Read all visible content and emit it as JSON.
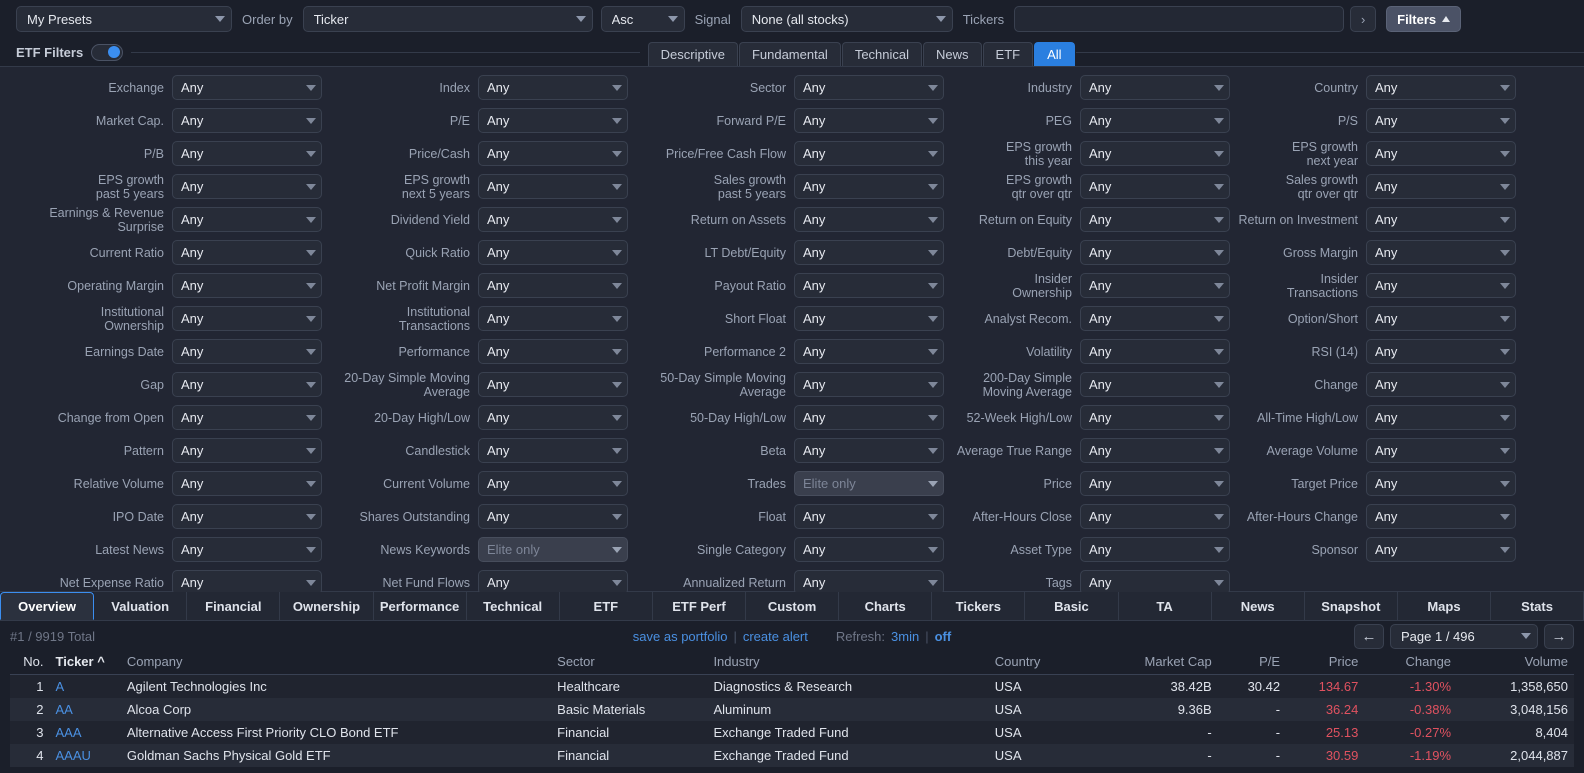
{
  "topbar": {
    "presets_value": "My Presets",
    "orderby_label": "Order by",
    "orderby_value": "Ticker",
    "direction_value": "Asc",
    "signal_label": "Signal",
    "signal_value": "None (all stocks)",
    "tickers_label": "Tickers",
    "tickers_value": "",
    "tickers_placeholder": "",
    "expand_icon": "chevron-right-icon",
    "filters_label": "Filters"
  },
  "secondbar": {
    "etf_filters_label": "ETF Filters",
    "etf_filters_on": true,
    "category_tabs": [
      {
        "label": "Descriptive",
        "active": false
      },
      {
        "label": "Fundamental",
        "active": false
      },
      {
        "label": "Technical",
        "active": false
      },
      {
        "label": "News",
        "active": false
      },
      {
        "label": "ETF",
        "active": false
      },
      {
        "label": "All",
        "active": true
      }
    ]
  },
  "filters": [
    [
      {
        "label": "Exchange",
        "value": "Any",
        "elite": false
      },
      {
        "label": "Index",
        "value": "Any",
        "elite": false
      },
      {
        "label": "Sector",
        "value": "Any",
        "elite": false
      },
      {
        "label": "Industry",
        "value": "Any",
        "elite": false
      },
      {
        "label": "Country",
        "value": "Any",
        "elite": false
      }
    ],
    [
      {
        "label": "Market Cap.",
        "value": "Any",
        "elite": false
      },
      {
        "label": "P/E",
        "value": "Any",
        "elite": false
      },
      {
        "label": "Forward P/E",
        "value": "Any",
        "elite": false
      },
      {
        "label": "PEG",
        "value": "Any",
        "elite": false
      },
      {
        "label": "P/S",
        "value": "Any",
        "elite": false
      }
    ],
    [
      {
        "label": "P/B",
        "value": "Any",
        "elite": false
      },
      {
        "label": "Price/Cash",
        "value": "Any",
        "elite": false
      },
      {
        "label": "Price/Free Cash Flow",
        "value": "Any",
        "elite": false
      },
      {
        "label": "EPS growth\nthis year",
        "value": "Any",
        "elite": false
      },
      {
        "label": "EPS growth\nnext year",
        "value": "Any",
        "elite": false
      }
    ],
    [
      {
        "label": "EPS growth\npast 5 years",
        "value": "Any",
        "elite": false
      },
      {
        "label": "EPS growth\nnext 5 years",
        "value": "Any",
        "elite": false
      },
      {
        "label": "Sales growth\npast 5 years",
        "value": "Any",
        "elite": false
      },
      {
        "label": "EPS growth\nqtr over qtr",
        "value": "Any",
        "elite": false
      },
      {
        "label": "Sales growth\nqtr over qtr",
        "value": "Any",
        "elite": false
      }
    ],
    [
      {
        "label": "Earnings & Revenue\nSurprise",
        "value": "Any",
        "elite": false
      },
      {
        "label": "Dividend Yield",
        "value": "Any",
        "elite": false
      },
      {
        "label": "Return on Assets",
        "value": "Any",
        "elite": false
      },
      {
        "label": "Return on Equity",
        "value": "Any",
        "elite": false
      },
      {
        "label": "Return on Investment",
        "value": "Any",
        "elite": false
      }
    ],
    [
      {
        "label": "Current Ratio",
        "value": "Any",
        "elite": false
      },
      {
        "label": "Quick Ratio",
        "value": "Any",
        "elite": false
      },
      {
        "label": "LT Debt/Equity",
        "value": "Any",
        "elite": false
      },
      {
        "label": "Debt/Equity",
        "value": "Any",
        "elite": false
      },
      {
        "label": "Gross Margin",
        "value": "Any",
        "elite": false
      }
    ],
    [
      {
        "label": "Operating Margin",
        "value": "Any",
        "elite": false
      },
      {
        "label": "Net Profit Margin",
        "value": "Any",
        "elite": false
      },
      {
        "label": "Payout Ratio",
        "value": "Any",
        "elite": false
      },
      {
        "label": "Insider\nOwnership",
        "value": "Any",
        "elite": false
      },
      {
        "label": "Insider\nTransactions",
        "value": "Any",
        "elite": false
      }
    ],
    [
      {
        "label": "Institutional\nOwnership",
        "value": "Any",
        "elite": false
      },
      {
        "label": "Institutional\nTransactions",
        "value": "Any",
        "elite": false
      },
      {
        "label": "Short Float",
        "value": "Any",
        "elite": false
      },
      {
        "label": "Analyst Recom.",
        "value": "Any",
        "elite": false
      },
      {
        "label": "Option/Short",
        "value": "Any",
        "elite": false
      }
    ],
    [
      {
        "label": "Earnings Date",
        "value": "Any",
        "elite": false
      },
      {
        "label": "Performance",
        "value": "Any",
        "elite": false
      },
      {
        "label": "Performance 2",
        "value": "Any",
        "elite": false
      },
      {
        "label": "Volatility",
        "value": "Any",
        "elite": false
      },
      {
        "label": "RSI (14)",
        "value": "Any",
        "elite": false
      }
    ],
    [
      {
        "label": "Gap",
        "value": "Any",
        "elite": false
      },
      {
        "label": "20-Day Simple Moving\nAverage",
        "value": "Any",
        "elite": false
      },
      {
        "label": "50-Day Simple Moving\nAverage",
        "value": "Any",
        "elite": false
      },
      {
        "label": "200-Day Simple\nMoving Average",
        "value": "Any",
        "elite": false
      },
      {
        "label": "Change",
        "value": "Any",
        "elite": false
      }
    ],
    [
      {
        "label": "Change from Open",
        "value": "Any",
        "elite": false
      },
      {
        "label": "20-Day High/Low",
        "value": "Any",
        "elite": false
      },
      {
        "label": "50-Day High/Low",
        "value": "Any",
        "elite": false
      },
      {
        "label": "52-Week High/Low",
        "value": "Any",
        "elite": false
      },
      {
        "label": "All-Time High/Low",
        "value": "Any",
        "elite": false
      }
    ],
    [
      {
        "label": "Pattern",
        "value": "Any",
        "elite": false
      },
      {
        "label": "Candlestick",
        "value": "Any",
        "elite": false
      },
      {
        "label": "Beta",
        "value": "Any",
        "elite": false
      },
      {
        "label": "Average True Range",
        "value": "Any",
        "elite": false
      },
      {
        "label": "Average Volume",
        "value": "Any",
        "elite": false
      }
    ],
    [
      {
        "label": "Relative Volume",
        "value": "Any",
        "elite": false
      },
      {
        "label": "Current Volume",
        "value": "Any",
        "elite": false
      },
      {
        "label": "Trades",
        "value": "Elite only",
        "elite": true
      },
      {
        "label": "Price",
        "value": "Any",
        "elite": false
      },
      {
        "label": "Target Price",
        "value": "Any",
        "elite": false
      }
    ],
    [
      {
        "label": "IPO Date",
        "value": "Any",
        "elite": false
      },
      {
        "label": "Shares Outstanding",
        "value": "Any",
        "elite": false
      },
      {
        "label": "Float",
        "value": "Any",
        "elite": false
      },
      {
        "label": "After-Hours Close",
        "value": "Any",
        "elite": false
      },
      {
        "label": "After-Hours Change",
        "value": "Any",
        "elite": false
      }
    ],
    [
      {
        "label": "Latest News",
        "value": "Any",
        "elite": false
      },
      {
        "label": "News Keywords",
        "value": "Elite only",
        "elite": true
      },
      {
        "label": "Single Category",
        "value": "Any",
        "elite": false
      },
      {
        "label": "Asset Type",
        "value": "Any",
        "elite": false
      },
      {
        "label": "Sponsor",
        "value": "Any",
        "elite": false
      }
    ],
    [
      {
        "label": "Net Expense Ratio",
        "value": "Any",
        "elite": false
      },
      {
        "label": "Net Fund Flows",
        "value": "Any",
        "elite": false
      },
      {
        "label": "Annualized Return",
        "value": "Any",
        "elite": false
      },
      {
        "label": "Tags",
        "value": "Any",
        "elite": false
      },
      {
        "label": "",
        "value": "",
        "elite": false
      }
    ]
  ],
  "view_tabs": [
    {
      "label": "Overview",
      "active": true
    },
    {
      "label": "Valuation",
      "active": false
    },
    {
      "label": "Financial",
      "active": false
    },
    {
      "label": "Ownership",
      "active": false
    },
    {
      "label": "Performance",
      "active": false
    },
    {
      "label": "Technical",
      "active": false
    },
    {
      "label": "ETF",
      "active": false
    },
    {
      "label": "ETF Perf",
      "active": false
    },
    {
      "label": "Custom",
      "active": false
    },
    {
      "label": "Charts",
      "active": false
    },
    {
      "label": "Tickers",
      "active": false
    },
    {
      "label": "Basic",
      "active": false
    },
    {
      "label": "TA",
      "active": false
    },
    {
      "label": "News",
      "active": false
    },
    {
      "label": "Snapshot",
      "active": false
    },
    {
      "label": "Maps",
      "active": false
    },
    {
      "label": "Stats",
      "active": false
    }
  ],
  "meta": {
    "total_text": "#1 / 9919 Total",
    "save_as_portfolio": "save as portfolio",
    "separator": "|",
    "create_alert": "create alert",
    "refresh_label": "Refresh:",
    "refresh_value": "3min",
    "refresh_sep": "|",
    "refresh_off": "off",
    "prev_icon": "arrow-left-icon",
    "next_icon": "arrow-right-icon",
    "page_value": "Page 1 / 496"
  },
  "table": {
    "columns": [
      {
        "label": "No.",
        "align": "right"
      },
      {
        "label": "Ticker ^",
        "align": "left"
      },
      {
        "label": "Company",
        "align": "left"
      },
      {
        "label": "Sector",
        "align": "left"
      },
      {
        "label": "Industry",
        "align": "left"
      },
      {
        "label": "Country",
        "align": "left"
      },
      {
        "label": "Market Cap",
        "align": "right"
      },
      {
        "label": "P/E",
        "align": "right"
      },
      {
        "label": "Price",
        "align": "right"
      },
      {
        "label": "Change",
        "align": "right"
      },
      {
        "label": "Volume",
        "align": "right"
      }
    ],
    "rows": [
      {
        "no": "1",
        "ticker": "A",
        "company": "Agilent Technologies Inc",
        "sector": "Healthcare",
        "industry": "Diagnostics & Research",
        "country": "USA",
        "market_cap": "38.42B",
        "pe": "30.42",
        "price": "134.67",
        "change": "-1.30%",
        "volume": "1,358,650"
      },
      {
        "no": "2",
        "ticker": "AA",
        "company": "Alcoa Corp",
        "sector": "Basic Materials",
        "industry": "Aluminum",
        "country": "USA",
        "market_cap": "9.36B",
        "pe": "-",
        "price": "36.24",
        "change": "-0.38%",
        "volume": "3,048,156"
      },
      {
        "no": "3",
        "ticker": "AAA",
        "company": "Alternative Access First Priority CLO Bond ETF",
        "sector": "Financial",
        "industry": "Exchange Traded Fund",
        "country": "USA",
        "market_cap": "-",
        "pe": "-",
        "price": "25.13",
        "change": "-0.27%",
        "volume": "8,404"
      },
      {
        "no": "4",
        "ticker": "AAAU",
        "company": "Goldman Sachs Physical Gold ETF",
        "sector": "Financial",
        "industry": "Exchange Traded Fund",
        "country": "USA",
        "market_cap": "-",
        "pe": "-",
        "price": "30.59",
        "change": "-1.19%",
        "volume": "2,044,887"
      }
    ]
  },
  "colors": {
    "accent_blue": "#3b8ef0",
    "link_blue": "#4a90e2",
    "negative_red": "#e05260",
    "panel_bg": "#222633",
    "page_bg": "#1b1f2a"
  }
}
